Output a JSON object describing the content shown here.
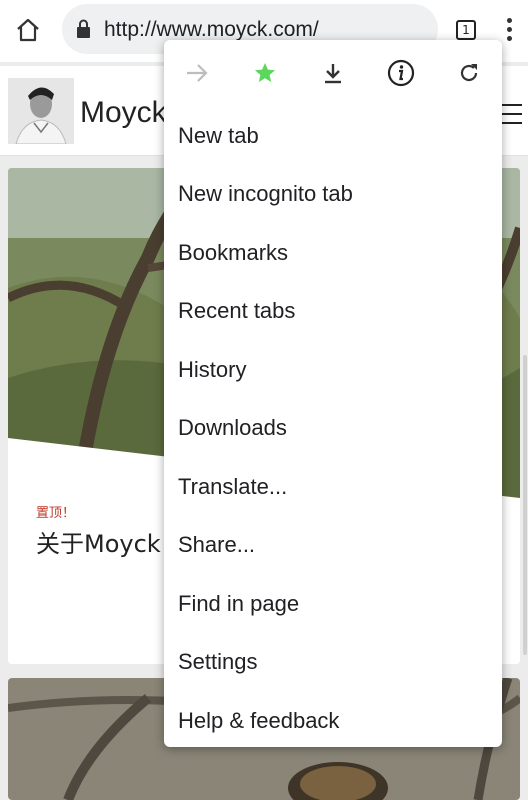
{
  "browser": {
    "url": "http://www.moyck.com/",
    "tab_count": "1"
  },
  "site": {
    "title": "Moyck"
  },
  "post": {
    "sticky_label": "置顶！",
    "title": "关于Moyck"
  },
  "menu": {
    "icons": [
      "forward-icon",
      "bookmark-star-icon",
      "download-icon",
      "info-icon",
      "reload-icon"
    ],
    "star_color": "#5cd65c",
    "items": [
      {
        "label": "New tab"
      },
      {
        "label": "New incognito tab"
      },
      {
        "label": "Bookmarks"
      },
      {
        "label": "Recent tabs"
      },
      {
        "label": "History"
      },
      {
        "label": "Downloads"
      },
      {
        "label": "Translate..."
      },
      {
        "label": "Share..."
      },
      {
        "label": "Find in page"
      },
      {
        "label": "Settings"
      },
      {
        "label": "Help & feedback"
      }
    ]
  }
}
